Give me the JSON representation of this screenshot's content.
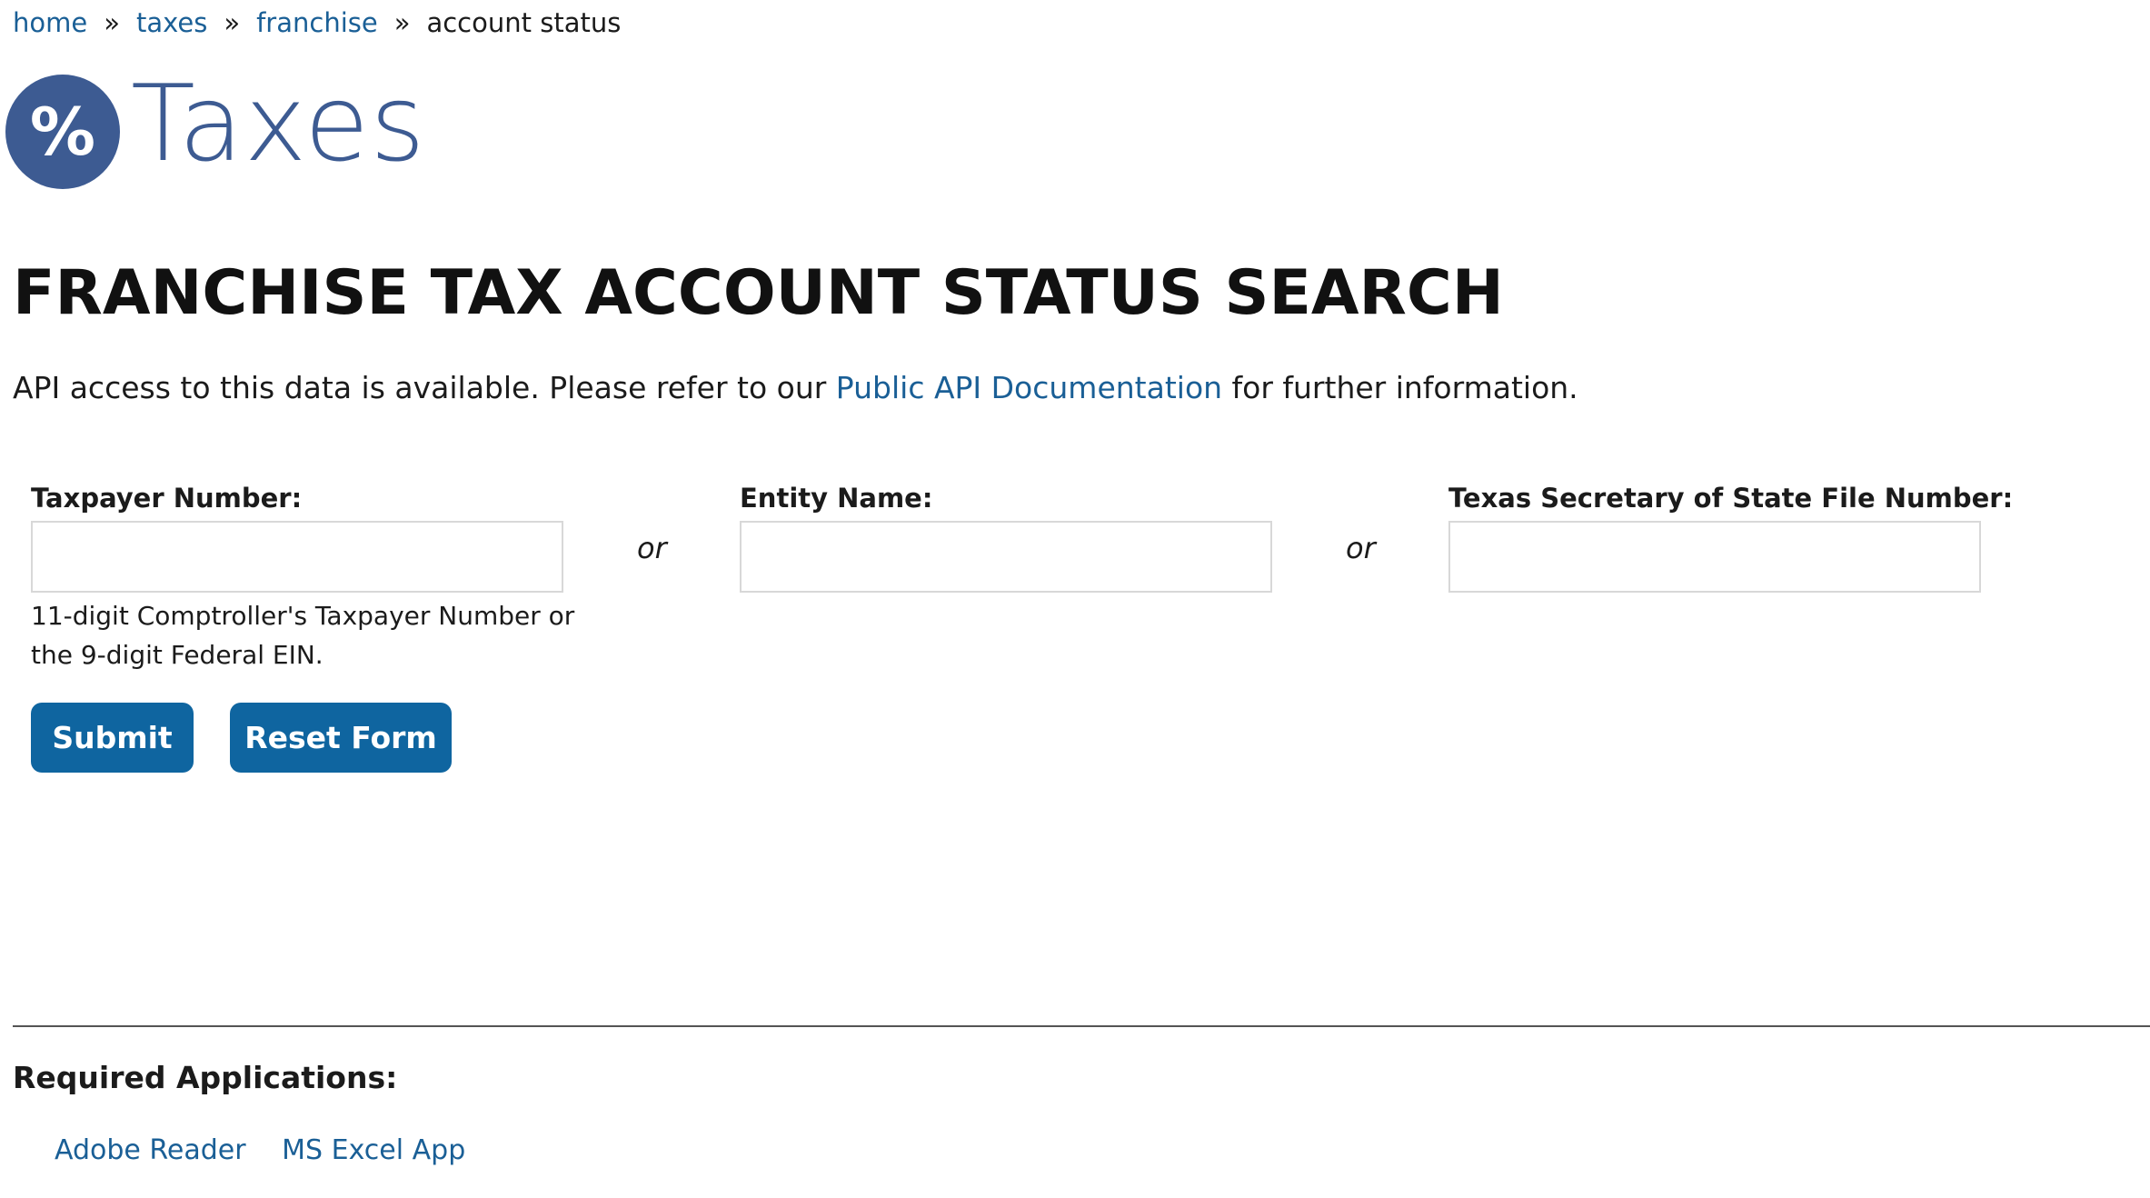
{
  "breadcrumb": {
    "items": [
      {
        "label": "home",
        "link": true
      },
      {
        "label": "taxes",
        "link": true
      },
      {
        "label": "franchise",
        "link": true
      },
      {
        "label": "account status",
        "link": false
      }
    ],
    "separator": "»"
  },
  "brand": {
    "icon_symbol": "%",
    "icon_name": "percent-icon",
    "text": "Taxes",
    "color": "#3d5b92"
  },
  "page": {
    "title": "FRANCHISE TAX ACCOUNT STATUS SEARCH",
    "api_note_before": "API access to this data is available. Please refer to our ",
    "api_link": "Public API Documentation",
    "api_note_after": " for further information."
  },
  "form": {
    "taxpayer_label": "Taxpayer Number:",
    "taxpayer_value": "",
    "taxpayer_hint": "11-digit Comptroller's Taxpayer Number or the 9-digit Federal EIN.",
    "or_text": "or",
    "entity_label": "Entity Name:",
    "entity_value": "",
    "sos_label": "Texas Secretary of State File Number:",
    "sos_value": "",
    "submit_label": "Submit",
    "reset_label": "Reset Form"
  },
  "required": {
    "title": "Required Applications:",
    "apps": [
      "Adobe Reader",
      "MS Excel App"
    ]
  },
  "colors": {
    "link": "#1a5f96",
    "button": "#0f65a0",
    "brand": "#3d5b92"
  }
}
